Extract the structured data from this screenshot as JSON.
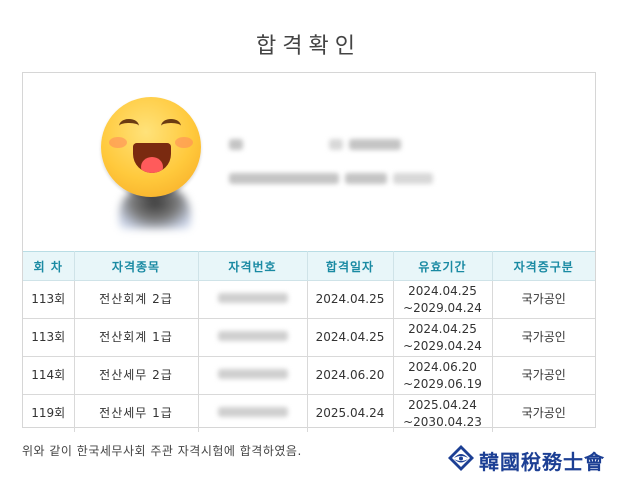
{
  "page": {
    "title": "합격확인"
  },
  "profile": {
    "photo_icon": "grinning-emoji-icon"
  },
  "table": {
    "headers": [
      "회 차",
      "자격종목",
      "자격번호",
      "합격일자",
      "유효기간",
      "자격증구분"
    ],
    "rows": [
      {
        "round": "113회",
        "subject": "전산회계  2급",
        "cert_no": "",
        "pass_date": "2024.04.25",
        "valid_from": "2024.04.25",
        "valid_to": "~2029.04.24",
        "type": "국가공인"
      },
      {
        "round": "113회",
        "subject": "전산회계  1급",
        "cert_no": "",
        "pass_date": "2024.04.25",
        "valid_from": "2024.04.25",
        "valid_to": "~2029.04.24",
        "type": "국가공인"
      },
      {
        "round": "114회",
        "subject": "전산세무  2급",
        "cert_no": "",
        "pass_date": "2024.06.20",
        "valid_from": "2024.06.20",
        "valid_to": "~2029.06.19",
        "type": "국가공인"
      },
      {
        "round": "119회",
        "subject": "전산세무  1급",
        "cert_no": "",
        "pass_date": "2025.04.24",
        "valid_from": "2025.04.24",
        "valid_to": "~2030.04.23",
        "type": "국가공인"
      }
    ]
  },
  "footer": {
    "statement": "위와 같이 한국세무사회 주관 자격시험에 합격하였음.",
    "logo_text": "韓國稅務士會"
  },
  "colors": {
    "header_bg": "#e8f6f9",
    "header_text": "#1a8aa3",
    "logo": "#1c3f94"
  }
}
